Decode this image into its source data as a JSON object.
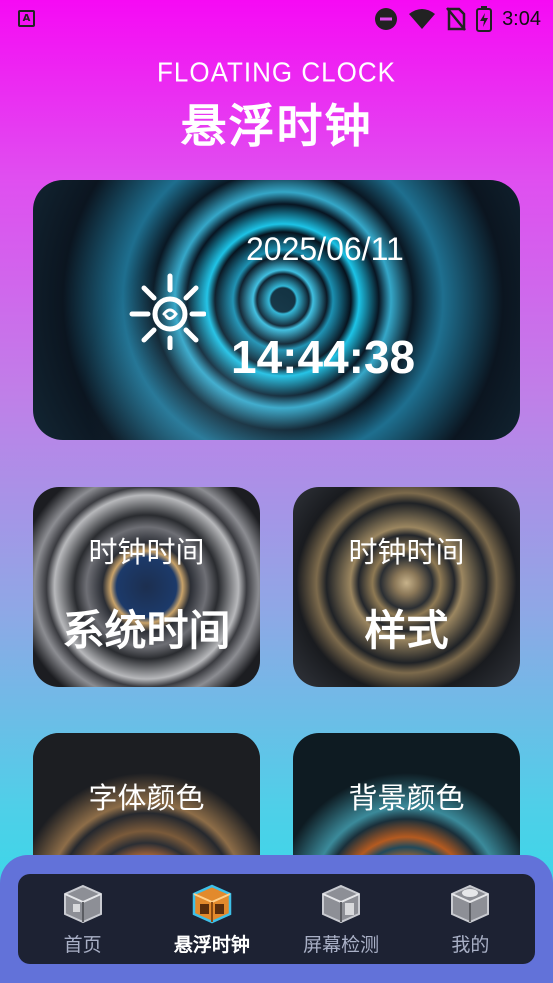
{
  "status_bar": {
    "app_icon_letter": "A",
    "time": "3:04"
  },
  "header": {
    "subtitle": "FLOATING CLOCK",
    "title": "悬浮时钟"
  },
  "clock_card": {
    "date": "2025/06/11",
    "time": "14:44:38"
  },
  "tiles": [
    {
      "sub": "时钟时间",
      "main": "系统时间"
    },
    {
      "sub": "时钟时间",
      "main": "样式"
    },
    {
      "sub": "字体颜色",
      "main": ""
    },
    {
      "sub": "背景颜色",
      "main": ""
    }
  ],
  "nav": {
    "items": [
      {
        "label": "首页",
        "icon": "home-cube-icon"
      },
      {
        "label": "悬浮时钟",
        "icon": "floating-clock-cube-icon",
        "active": true
      },
      {
        "label": "屏幕检测",
        "icon": "screen-check-cube-icon"
      },
      {
        "label": "我的",
        "icon": "profile-cube-icon"
      }
    ]
  },
  "colors": {
    "gradient_top": "#f60af4",
    "gradient_bottom": "#27e0ea",
    "nav_background": "#6272d9",
    "nav_inner": "#1d2233",
    "nav_active_accent": "#e28a2c"
  }
}
